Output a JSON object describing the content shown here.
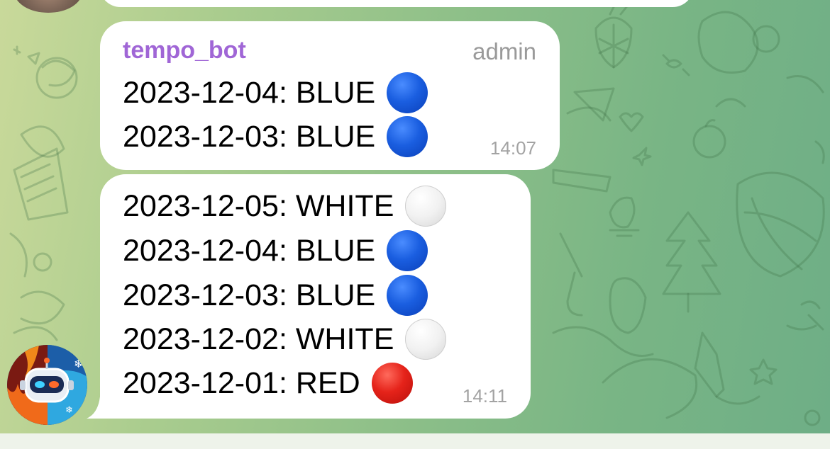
{
  "messages": [
    {
      "sender": "tempo_bot",
      "role": "admin",
      "lines": [
        {
          "text": "2023-12-04: BLUE",
          "color": "blue"
        },
        {
          "text": "2023-12-03: BLUE",
          "color": "blue"
        }
      ],
      "time": "14:07"
    },
    {
      "lines": [
        {
          "text": "2023-12-05: WHITE",
          "color": "white"
        },
        {
          "text": "2023-12-04: BLUE",
          "color": "blue"
        },
        {
          "text": "2023-12-03: BLUE",
          "color": "blue"
        },
        {
          "text": "2023-12-02: WHITE",
          "color": "white"
        },
        {
          "text": "2023-12-01: RED",
          "color": "red"
        }
      ],
      "time": "14:11"
    }
  ],
  "colors": {
    "sender_name": "#a066d6",
    "blue_dot": "#1a5ee0",
    "white_dot": "#f1f1f1",
    "red_dot": "#e5231a",
    "chat_background": "#8fc089"
  },
  "icons": {
    "blue": "blue-circle-icon",
    "white": "white-circle-icon",
    "red": "red-circle-icon",
    "bot_avatar": "robot-icon"
  }
}
